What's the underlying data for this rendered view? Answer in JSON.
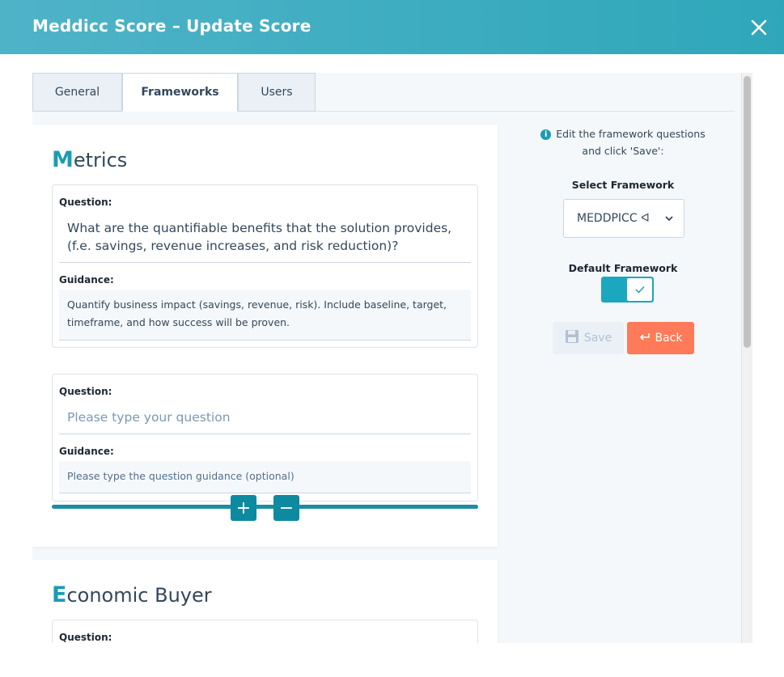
{
  "header": {
    "title": "Meddicc Score – Update Score",
    "close_icon": "close-icon"
  },
  "tabs": [
    {
      "label": "General",
      "active": false
    },
    {
      "label": "Frameworks",
      "active": true
    },
    {
      "label": "Users",
      "active": false
    }
  ],
  "sections": [
    {
      "initial": "M",
      "rest": "etrics",
      "questions": [
        {
          "question_label": "Question:",
          "question_value": "What are the quantifiable benefits that the solution provides, (f.e. savings, revenue increases, and risk reduction)?",
          "guidance_label": "Guidance:",
          "guidance_value": "Quantify business impact (savings, revenue, risk). Include baseline, target, timeframe, and how success will be proven."
        },
        {
          "question_label": "Question:",
          "question_placeholder": "Please type your question",
          "guidance_label": "Guidance:",
          "guidance_placeholder": "Please type the question guidance (optional)"
        }
      ],
      "add_label": "+",
      "remove_label": "−"
    },
    {
      "initial": "E",
      "rest": "conomic Buyer",
      "questions": [
        {
          "question_label": "Question:"
        }
      ]
    }
  ],
  "side_panel": {
    "info_line1": "Edit the framework questions",
    "info_line2": "and click 'Save':",
    "select_label": "Select Framework",
    "select_value": "MEDDPICC ᐊ",
    "default_label": "Default Framework",
    "default_on": true,
    "save_label": "Save",
    "back_label": "Back"
  },
  "colors": {
    "accent": "#1a9cb4",
    "back_button": "#ff7a59",
    "header_start": "#4fb3c8",
    "header_end": "#2fa7ba"
  }
}
